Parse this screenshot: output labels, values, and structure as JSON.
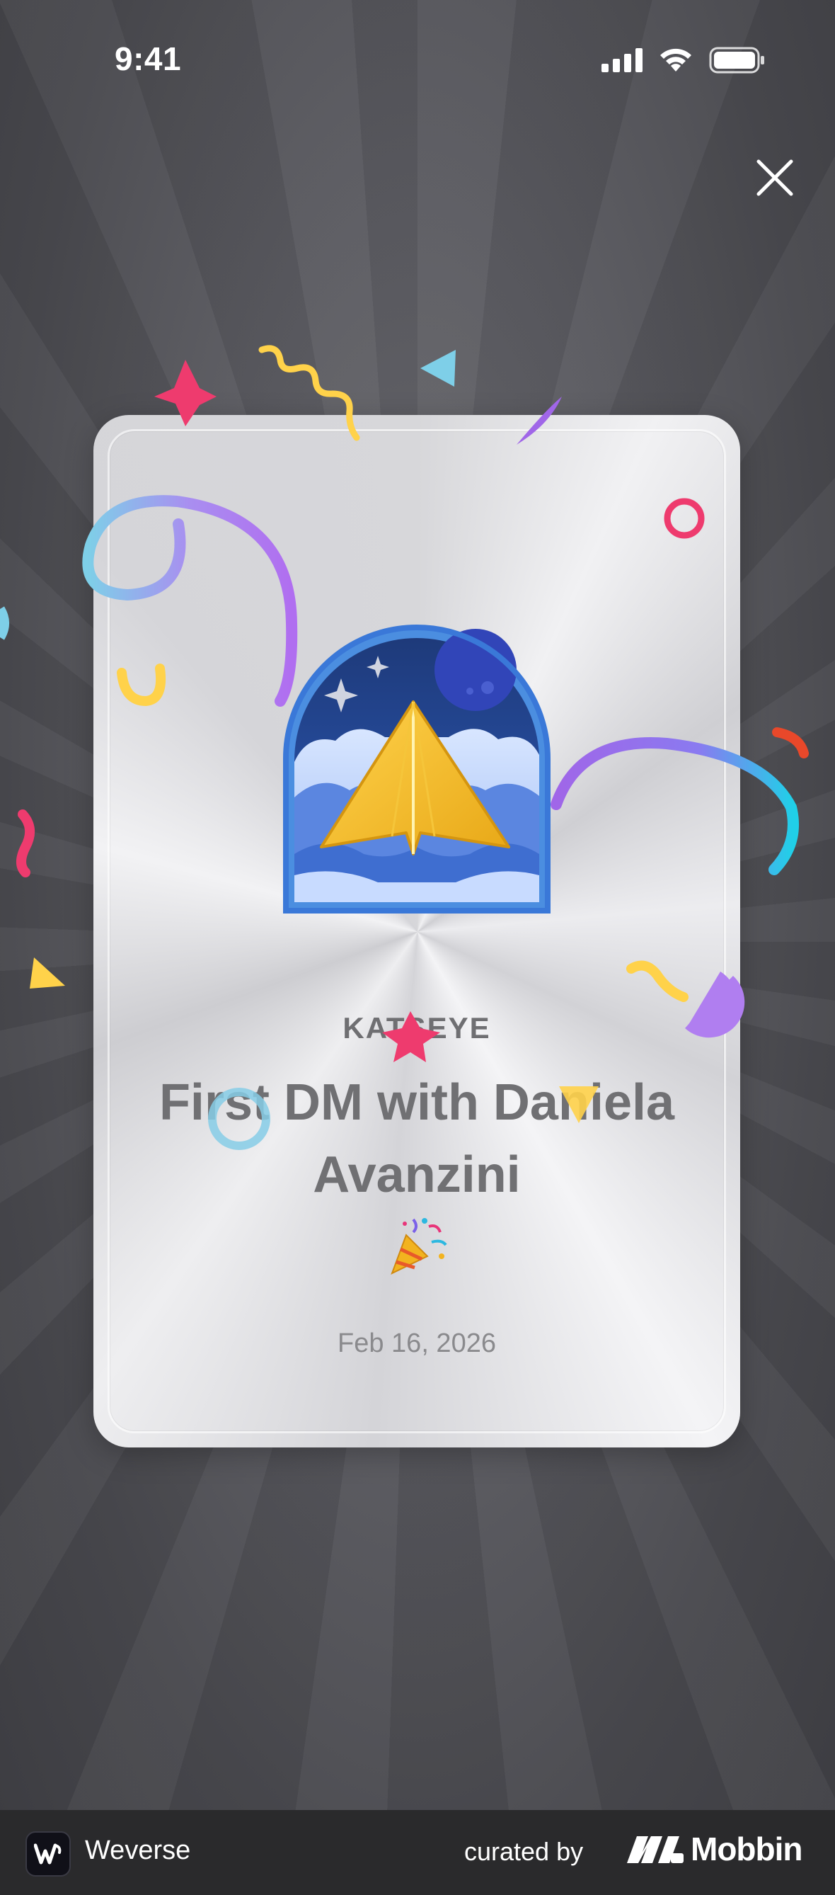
{
  "status_bar": {
    "time": "9:41"
  },
  "card": {
    "artist": "KATSEYE",
    "title": "First DM with Daniela Avanzini",
    "emoji": "party-popper",
    "date": "Feb 16, 2026"
  },
  "icons": {
    "close": "close-icon",
    "badge": "paper-plane-badge",
    "signal": "signal-icon",
    "wifi": "wifi-icon",
    "battery": "battery-icon"
  },
  "footer": {
    "app_name": "Weverse",
    "curated_by": "curated by",
    "brand": "Mobbin"
  },
  "colors": {
    "background": "#55555a",
    "card": "#e4e4e7",
    "text": "#707073",
    "footer": "#2a2a2c"
  }
}
